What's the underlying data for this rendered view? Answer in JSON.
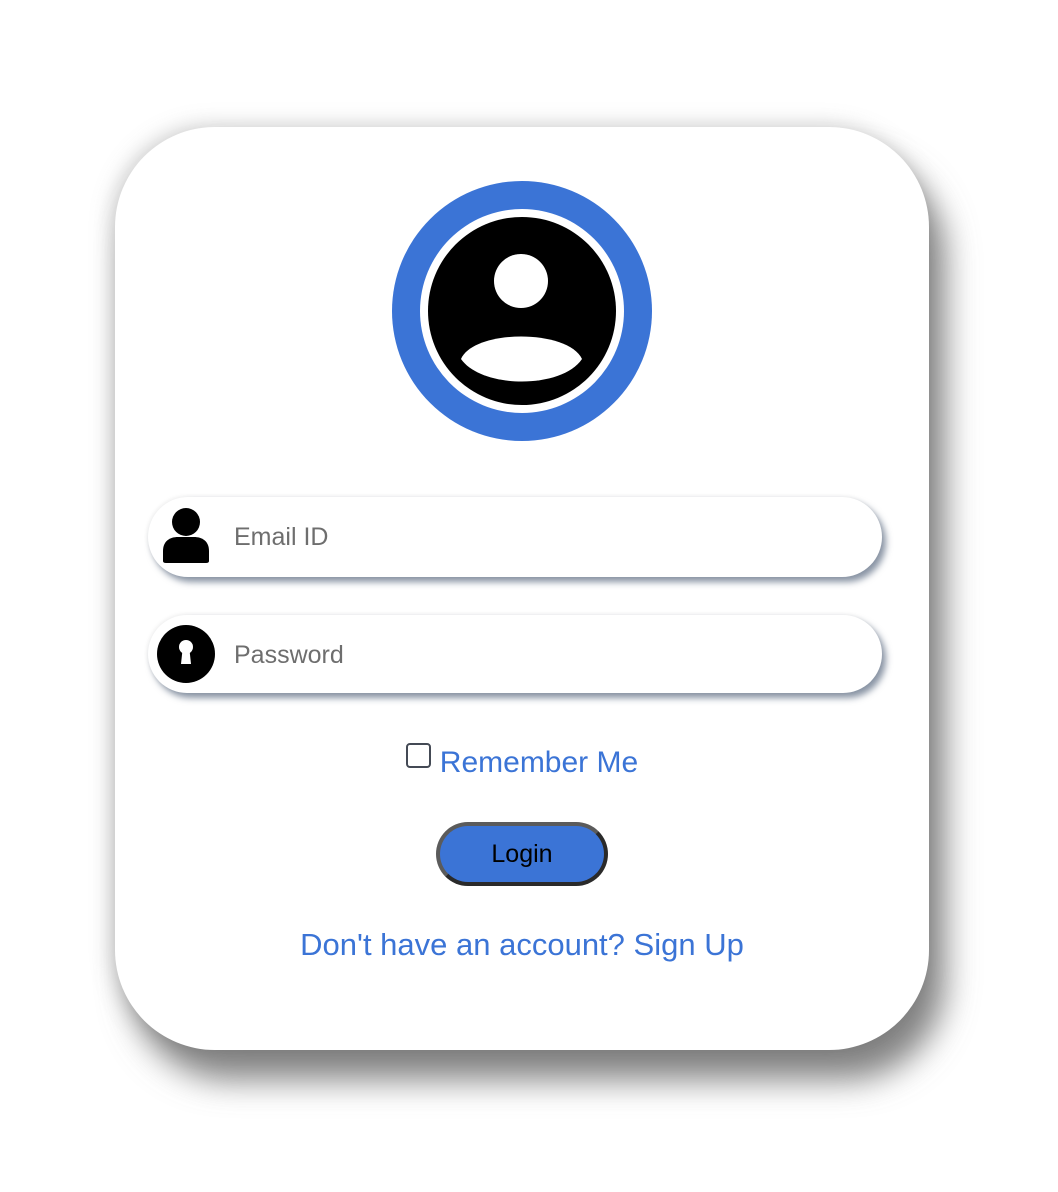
{
  "form": {
    "email": {
      "value": "",
      "placeholder": "Email ID",
      "icon": "user-icon"
    },
    "password": {
      "value": "",
      "placeholder": "Password",
      "icon": "keyhole-icon"
    },
    "remember_label": "Remember Me",
    "remember_checked": false,
    "login_label": "Login",
    "signup_prompt": "Don't have an account?",
    "signup_link": "Sign Up"
  },
  "avatar": {
    "icon": "user-avatar-icon"
  },
  "colors": {
    "accent": "#3b74d6",
    "text": "#000000",
    "card": "#ffffff"
  }
}
